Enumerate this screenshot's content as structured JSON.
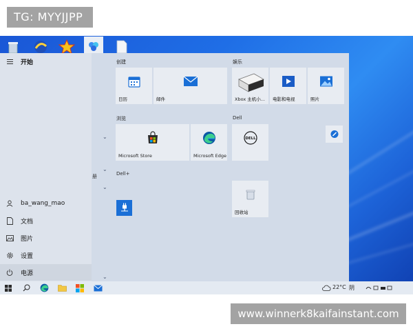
{
  "watermarks": {
    "tg": "TG: MYYJJPP",
    "url": "www.winnerk8kaifainstant.com"
  },
  "start_menu": {
    "header": {
      "label": "开始"
    },
    "sidebar": {
      "user": "ba_wang_mao",
      "items": [
        {
          "label": "文档",
          "icon": "document-icon"
        },
        {
          "label": "图片",
          "icon": "pictures-icon"
        },
        {
          "label": "设置",
          "icon": "gear-icon"
        },
        {
          "label": "电源",
          "icon": "power-icon"
        }
      ]
    },
    "list_fragment": "册",
    "groups": [
      {
        "title": "创建",
        "tiles": [
          {
            "label": "日历"
          },
          {
            "label": "邮件"
          }
        ]
      },
      {
        "title": "娱乐",
        "tiles": [
          {
            "label": "Xbox 主机小..."
          },
          {
            "label": "电影和电视"
          },
          {
            "label": "照片"
          }
        ]
      },
      {
        "title": "浏览",
        "tiles": [
          {
            "label": "Microsoft Store"
          },
          {
            "label": "Microsoft Edge"
          }
        ]
      },
      {
        "title": "Dell",
        "tiles": [
          {
            "label": ""
          }
        ]
      },
      {
        "title": "Dell+",
        "tiles": [
          {
            "label": ""
          }
        ]
      },
      {
        "title": "",
        "tiles": [
          {
            "label": "回收站"
          }
        ]
      }
    ]
  },
  "taskbar": {
    "temperature": "22°C",
    "tray_text": "阴"
  },
  "colors": {
    "desktop_blue": "#1f6ee6",
    "tile_bg": "#e8ecf2",
    "menu_bg": "#dde3ec"
  }
}
